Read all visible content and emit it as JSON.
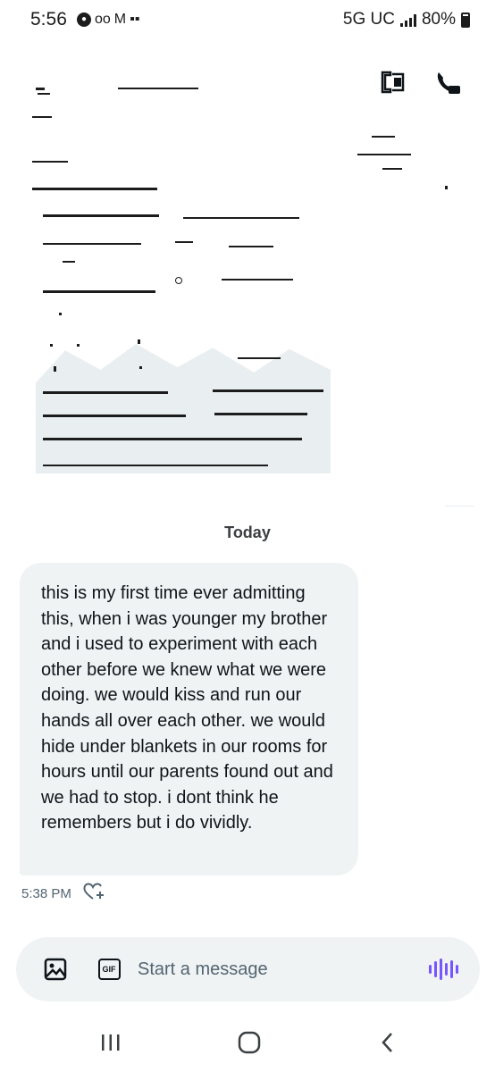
{
  "status_bar": {
    "time": "5:56",
    "network": "5G UC",
    "battery_percent": "80%"
  },
  "header": {
    "actions": [
      {
        "icon": "screenshot-icon"
      },
      {
        "icon": "phone-call-icon"
      }
    ]
  },
  "conversation": {
    "date_separator": "Today",
    "messages": [
      {
        "text": "this is my first time ever admitting this, when i was younger my brother and i used to experiment with each other before we knew what we were doing. we would kiss and run our hands all over each other. we would hide under blankets in our rooms for hours until our parents found out and we had to stop. i dont think he remembers but i do vividly.",
        "time": "5:38 PM",
        "reaction_icon": "add-reaction-icon"
      }
    ]
  },
  "composer": {
    "placeholder": "Start a message",
    "media_icon": "image-icon",
    "gif_label": "GIF",
    "voice_icon": "voice-message-icon",
    "accent_color": "#7856ff"
  },
  "colors": {
    "bubble_bg": "#eff3f4",
    "text": "#0f1419",
    "secondary_text": "#536471"
  }
}
